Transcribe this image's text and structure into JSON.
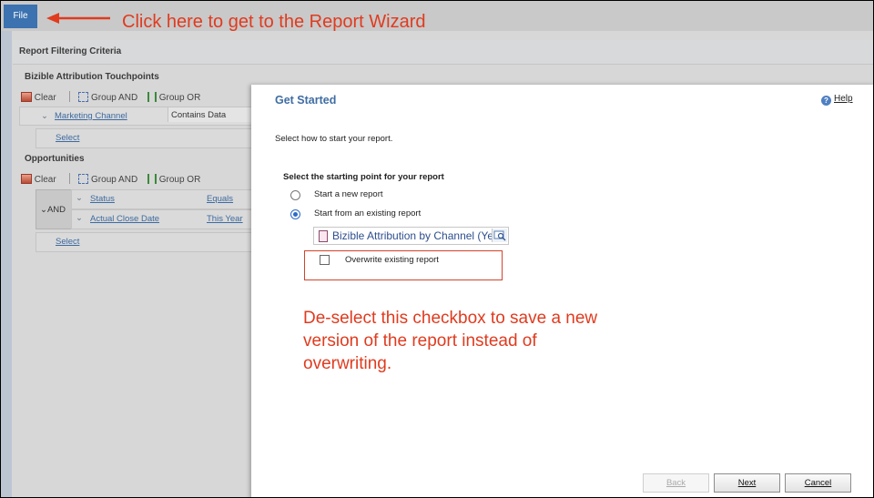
{
  "topbar": {
    "file_label": "File"
  },
  "callout": {
    "text": "Click here to get to the Report Wizard"
  },
  "criteria": {
    "title": "Report Filtering Criteria",
    "touchpoints": {
      "title": "Bizible Attribution Touchpoints",
      "toolbar": {
        "clear": "Clear",
        "group_and": "Group AND",
        "group_or": "Group OR"
      },
      "field": "Marketing Channel",
      "operator": "Contains Data",
      "select": "Select"
    },
    "opportunities": {
      "title": "Opportunities",
      "toolbar": {
        "clear": "Clear",
        "group_and": "Group AND",
        "group_or": "Group OR"
      },
      "group_label": "AND",
      "rows": [
        {
          "field": "Status",
          "operator": "Equals"
        },
        {
          "field": "Actual Close Date",
          "operator": "This Year"
        }
      ],
      "select": "Select"
    }
  },
  "dialog": {
    "title": "Get Started",
    "help": "Help",
    "instruction": "Select how to start your report.",
    "section_title": "Select the starting point for your report",
    "options": [
      {
        "label": "Start a new report",
        "selected": false
      },
      {
        "label": "Start from an existing report",
        "selected": true
      }
    ],
    "existing_report": "Bizible Attribution by Channel (Ye",
    "overwrite_label": "Overwrite existing report",
    "overwrite_checked": false,
    "note": "De-select this checkbox to save a new version of the report instead of overwriting.",
    "buttons": {
      "back": "Back",
      "next": "Next",
      "cancel": "Cancel"
    }
  },
  "colors": {
    "accent": "#3f6da3",
    "annotation": "#e03b1f",
    "file_button": "#3c72b0"
  }
}
